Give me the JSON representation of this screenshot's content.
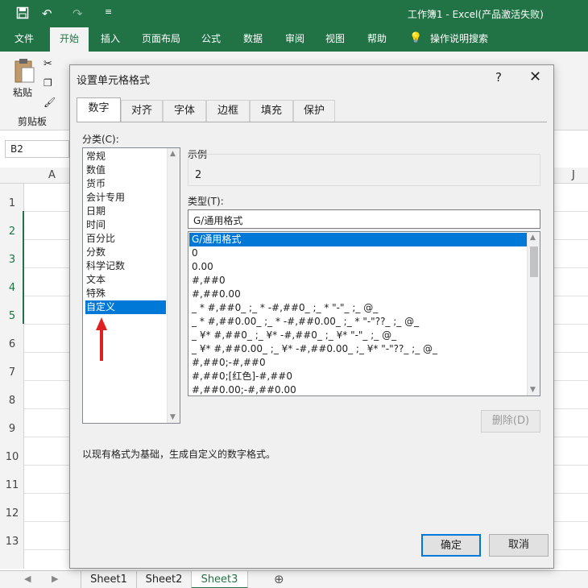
{
  "window": {
    "title": "工作簿1 - Excel(产品激活失败)"
  },
  "qat": {
    "save_icon": "save-icon",
    "undo_icon": "undo-icon",
    "redo_icon": "redo-icon"
  },
  "ribbon": {
    "tabs": [
      "文件",
      "开始",
      "插入",
      "页面布局",
      "公式",
      "数据",
      "审阅",
      "视图",
      "帮助",
      "操作说明搜索"
    ],
    "active_tab": "开始",
    "clipboard_group": {
      "paste": "粘贴",
      "label": "剪贴板"
    }
  },
  "name_box": "B2",
  "columns": [
    "A",
    "J"
  ],
  "rows": [
    "1",
    "2",
    "3",
    "4",
    "5",
    "6",
    "7",
    "8",
    "9",
    "10",
    "11",
    "12",
    "13"
  ],
  "sheets": [
    "Sheet1",
    "Sheet2",
    "Sheet3"
  ],
  "active_sheet": "Sheet3",
  "dialog": {
    "title": "设置单元格格式",
    "help": "?",
    "close": "✕",
    "tabs": [
      "数字",
      "对齐",
      "字体",
      "边框",
      "填充",
      "保护"
    ],
    "active_tab": "数字",
    "category_label": "分类(C):",
    "categories": [
      "常规",
      "数值",
      "货币",
      "会计专用",
      "日期",
      "时间",
      "百分比",
      "分数",
      "科学记数",
      "文本",
      "特殊",
      "自定义"
    ],
    "selected_category": "自定义",
    "sample_label": "示例",
    "sample_value": "2",
    "type_label": "类型(T):",
    "type_value": "G/通用格式",
    "formats": [
      "G/通用格式",
      "0",
      "0.00",
      "#,##0",
      "#,##0.00",
      "_ * #,##0_ ;_ * -#,##0_ ;_ * \"-\"_ ;_ @_",
      "_ * #,##0.00_ ;_ * -#,##0.00_ ;_ * \"-\"??_ ;_ @_",
      "_ ¥* #,##0_ ;_ ¥* -#,##0_ ;_ ¥* \"-\"_ ;_ @_",
      "_ ¥* #,##0.00_ ;_ ¥* -#,##0.00_ ;_ ¥* \"-\"??_ ;_ @_",
      "#,##0;-#,##0",
      "#,##0;[红色]-#,##0",
      "#,##0.00;-#,##0.00"
    ],
    "delete_button": "删除(D)",
    "description": "以现有格式为基础，生成自定义的数字格式。",
    "ok_button": "确定",
    "cancel_button": "取消"
  },
  "colors": {
    "excel_green": "#217346",
    "selection_blue": "#0078d7",
    "arrow_red": "#e02020"
  }
}
